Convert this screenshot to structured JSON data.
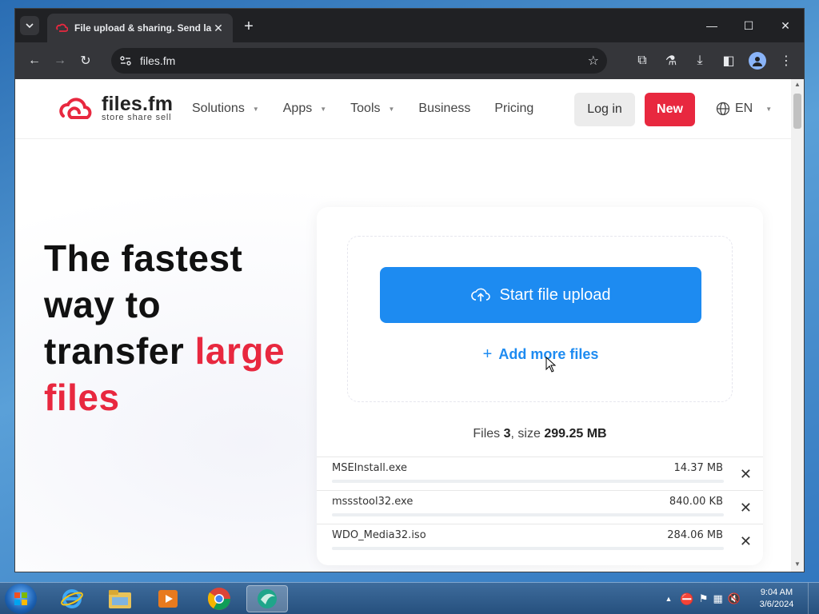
{
  "browser": {
    "tab_title": "File upload & sharing. Send lar",
    "url": "files.fm"
  },
  "site": {
    "logo_name": "files.fm",
    "logo_tagline": "store share sell",
    "nav": [
      {
        "label": "Solutions",
        "has_caret": true
      },
      {
        "label": "Apps",
        "has_caret": true
      },
      {
        "label": "Tools",
        "has_caret": true
      },
      {
        "label": "Business",
        "has_caret": false
      },
      {
        "label": "Pricing",
        "has_caret": false
      }
    ],
    "login_label": "Log in",
    "new_label": "New",
    "lang_label": "EN"
  },
  "hero": {
    "line1": "The fastest",
    "line2": "way to",
    "line3_a": "transfer ",
    "line3_b": "large",
    "line4": "files"
  },
  "upload": {
    "start_label": "Start file upload",
    "add_more_label": "Add more files",
    "summary_files_label": "Files",
    "summary_files_count": "3",
    "summary_size_label": ", size",
    "summary_size_value": "299.25 MB",
    "files": [
      {
        "name": "MSEInstall.exe",
        "size": "14.37 MB"
      },
      {
        "name": "mssstool32.exe",
        "size": "840.00 KB"
      },
      {
        "name": "WDO_Media32.iso",
        "size": "284.06 MB"
      }
    ]
  },
  "taskbar": {
    "time": "9:04 AM",
    "date": "3/6/2024"
  },
  "colors": {
    "brand_red": "#e8283f",
    "brand_blue": "#1d8bf1"
  }
}
